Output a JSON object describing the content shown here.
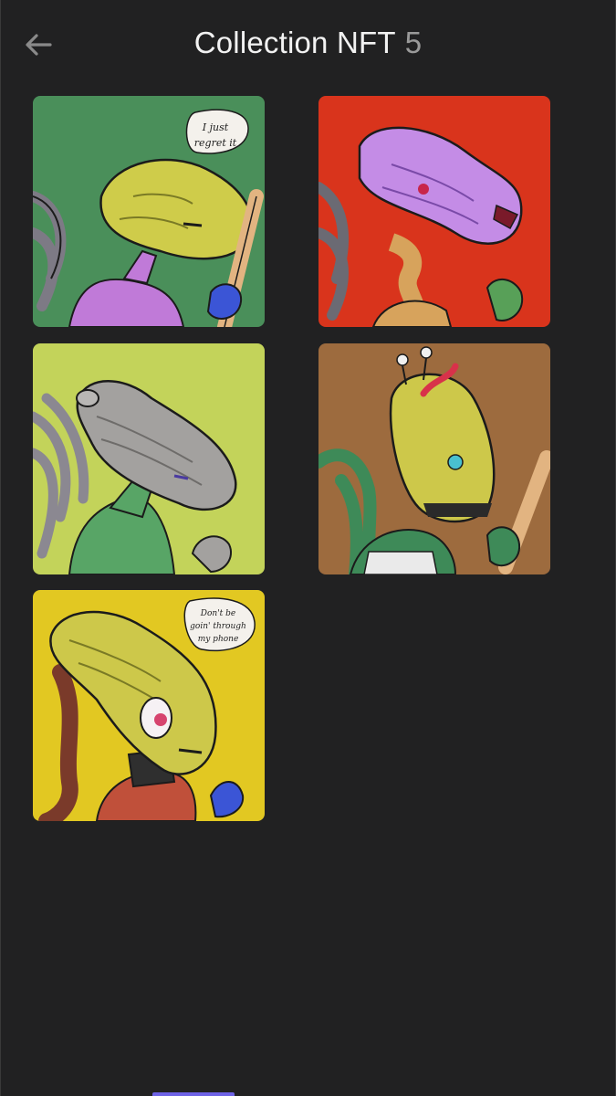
{
  "header": {
    "title": "Collection NFT",
    "count": "5",
    "back_icon": "arrow-left-icon"
  },
  "collection": {
    "items": [
      {
        "name": "nft-card-1",
        "background": "#4a8f5a",
        "speech": [
          "I just",
          "regret it"
        ]
      },
      {
        "name": "nft-card-2",
        "background": "#d9341c",
        "speech": []
      },
      {
        "name": "nft-card-3",
        "background": "#c3d35a",
        "speech": []
      },
      {
        "name": "nft-card-4",
        "background": "#9d6b3e",
        "speech": []
      },
      {
        "name": "nft-card-5",
        "background": "#e2c822",
        "speech": [
          "Don't be",
          "goin' through",
          "my phone"
        ]
      }
    ]
  },
  "colors": {
    "screen_bg": "#212122",
    "accent": "#6e63e6",
    "title": "#f2f2f2",
    "count": "#9a9a9a"
  }
}
